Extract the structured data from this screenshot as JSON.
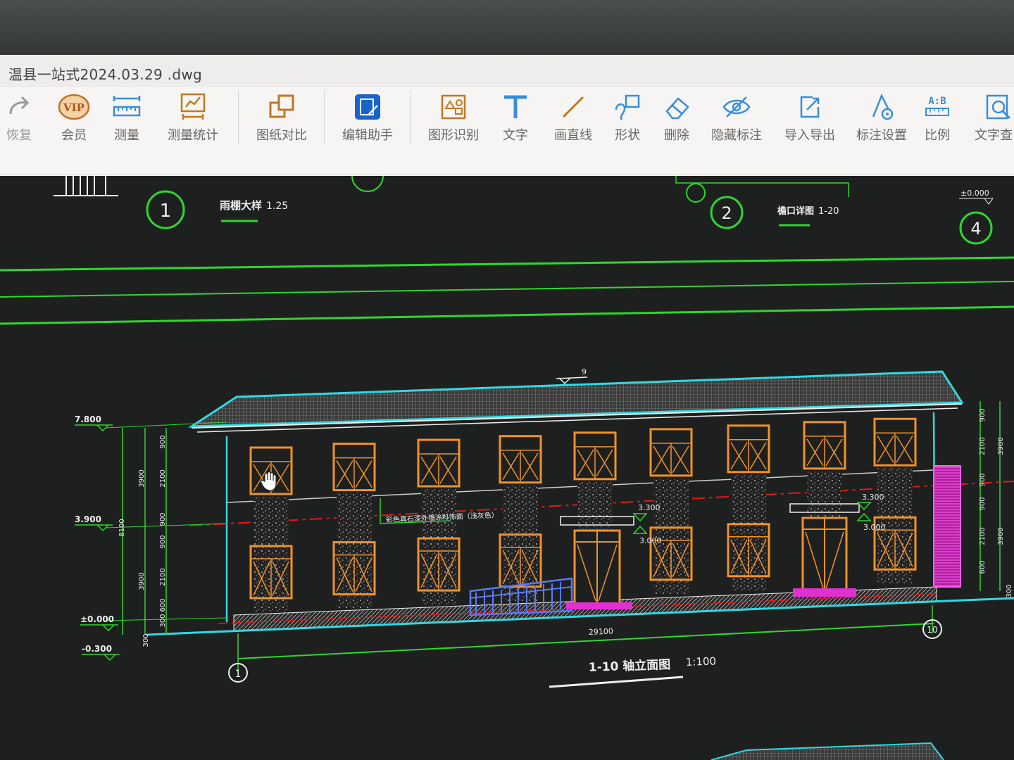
{
  "window": {
    "title": "温县一站式2024.03.29 .dwg"
  },
  "toolbar": {
    "items": [
      {
        "label": "恢复",
        "icon": "redo-icon"
      },
      {
        "label": "会员",
        "icon": "vip-icon"
      },
      {
        "label": "测量",
        "icon": "ruler-icon"
      },
      {
        "label": "测量统计",
        "icon": "measure-stats-icon"
      },
      {
        "label": "图纸对比",
        "icon": "compare-icon"
      },
      {
        "label": "编辑助手",
        "icon": "cad-edit-icon"
      },
      {
        "label": "图形识别",
        "icon": "shape-recognize-icon"
      },
      {
        "label": "文字",
        "icon": "text-icon"
      },
      {
        "label": "画直线",
        "icon": "line-icon"
      },
      {
        "label": "形状",
        "icon": "shape-icon"
      },
      {
        "label": "删除",
        "icon": "eraser-icon"
      },
      {
        "label": "隐藏标注",
        "icon": "hide-eye-icon"
      },
      {
        "label": "导入导出",
        "icon": "import-export-icon"
      },
      {
        "label": "标注设置",
        "icon": "annotation-settings-icon"
      },
      {
        "label": "比例",
        "icon": "scale-icon"
      },
      {
        "label": "文字查",
        "icon": "text-search-icon"
      }
    ],
    "scale_icon_text": "A:B",
    "vip_icon_text": "VIP"
  },
  "drawing": {
    "detail_labels": [
      {
        "number": "1",
        "title": "雨棚大样",
        "scale": "1.25"
      },
      {
        "number": "2",
        "title": "檐口详图",
        "scale": "1-20"
      },
      {
        "number": "4",
        "title": "",
        "scale": ""
      }
    ],
    "top_right_elevation": "±0.000",
    "elevation_title": "1-10 轴立面图",
    "elevation_scale": "1:100",
    "axis_start": "1",
    "axis_end": "10",
    "total_length": "29100",
    "level_labels": [
      "7.800",
      "3.900",
      "±0.000",
      "-0.300"
    ],
    "inner_levels": [
      "3.300",
      "3.000",
      "3.300",
      "3.000"
    ],
    "material_note": "彩色真石漆外墙涂料饰面（浅灰色）",
    "left_dims": [
      "3900",
      "3900",
      "900",
      "2100",
      "900",
      "900",
      "2100",
      "600",
      "300",
      "300",
      "8100"
    ],
    "right_dims": [
      "900",
      "2100",
      "900",
      "3900",
      "900",
      "2100",
      "600",
      "3900",
      "300"
    ],
    "ridge_mark": "9"
  },
  "colors": {
    "canvas_bg": "#1e201f",
    "axis_green": "#2fd62f",
    "window_orange": "#f0922a",
    "roof_cyan": "#32d8e0",
    "level_red": "#e01a1a",
    "accent_magenta": "#e030d0",
    "railing_blue": "#5a7aff"
  }
}
